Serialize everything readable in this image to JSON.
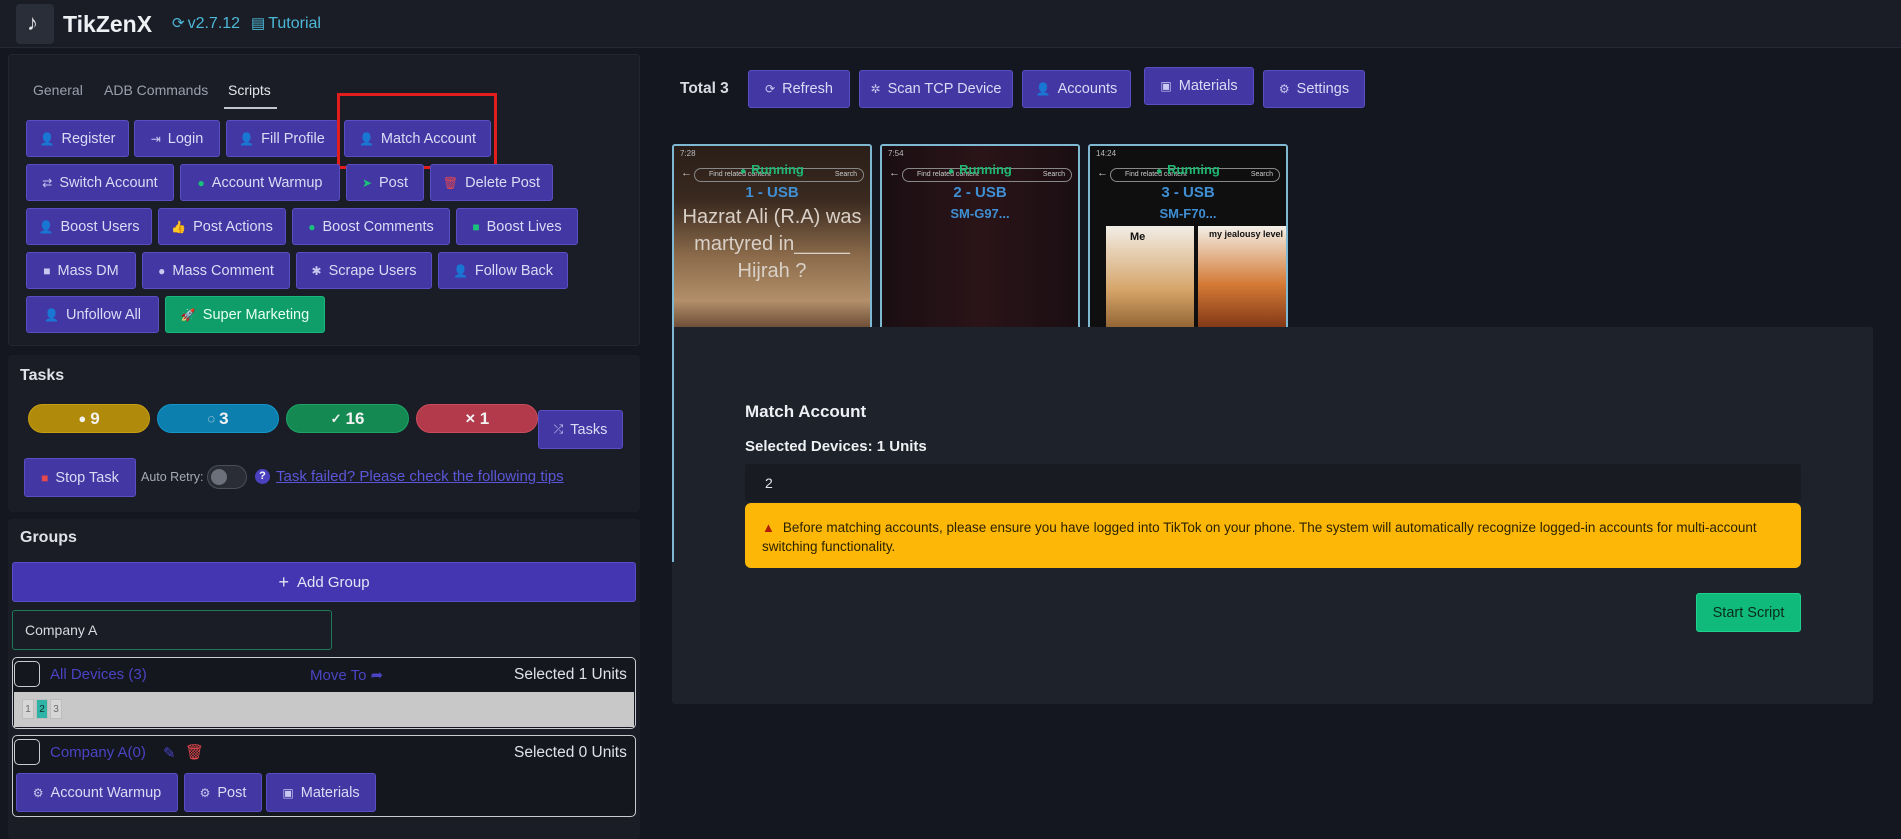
{
  "header": {
    "app_title": "TikZenX",
    "version": "v2.7.12",
    "tutorial": "Tutorial"
  },
  "tabs": [
    "General",
    "ADB Commands",
    "Scripts"
  ],
  "active_tab": "Scripts",
  "script_buttons": {
    "register": "Register",
    "login": "Login",
    "fill_profile": "Fill Profile",
    "match_account": "Match Account",
    "switch_account": "Switch Account",
    "account_warmup": "Account Warmup",
    "post": "Post",
    "delete_post": "Delete Post",
    "boost_users": "Boost Users",
    "post_actions": "Post Actions",
    "boost_comments": "Boost Comments",
    "boost_lives": "Boost Lives",
    "mass_dm": "Mass DM",
    "mass_comment": "Mass Comment",
    "scrape_users": "Scrape Users",
    "follow_back": "Follow Back",
    "unfollow_all": "Unfollow All",
    "super_marketing": "Super Marketing"
  },
  "tasks": {
    "title": "Tasks",
    "counts": {
      "pending": "9",
      "running": "3",
      "success": "16",
      "failed": "1"
    },
    "tasks_button": "Tasks",
    "stop_task": "Stop Task",
    "auto_retry_label": "Auto Retry:",
    "auto_retry": false,
    "tip_link": "Task failed? Please check the following tips"
  },
  "groups": {
    "title": "Groups",
    "add_group": "Add Group",
    "input_value": "Company A",
    "all_devices": {
      "name": "All Devices (3)",
      "move_to": "Move To",
      "selected": "Selected 1 Units",
      "chips": [
        "1",
        "2",
        "3"
      ]
    },
    "company": {
      "name": "Company A(0)",
      "selected": "Selected 0 Units",
      "buttons": [
        "Account Warmup",
        "Post",
        "Materials"
      ]
    }
  },
  "toolbar": {
    "total": "Total 3",
    "refresh": "Refresh",
    "scan": "Scan TCP Device",
    "accounts": "Accounts",
    "materials": "Materials",
    "settings": "Settings"
  },
  "devices": [
    {
      "status": "Running",
      "id": "1 - USB",
      "model": "",
      "screen_text": "Hazrat Ali (R.A) was martyred in_____ Hijrah  ?",
      "search_placeholder": "Find related content",
      "search_button": "Search",
      "status_time": "7:28"
    },
    {
      "status": "Running",
      "id": "2 - USB",
      "model": "SM-G97...",
      "search_placeholder": "Find related content",
      "search_button": "Search",
      "status_time": "7:54"
    },
    {
      "status": "Running",
      "id": "3 - USB",
      "model": "SM-F70...",
      "search_placeholder": "Find related content",
      "search_button": "Search",
      "status_time": "14:24",
      "meme_left": "Me",
      "meme_right": "my jealousy level"
    }
  ],
  "modal": {
    "title": "Match Account",
    "selected_devices": "Selected Devices: 1 Units",
    "input_value": "2",
    "warning": "Before matching accounts, please ensure you have logged into TikTok on your phone. The system will automatically recognize logged-in accounts for multi-account switching functionality.",
    "start_button": "Start Script"
  },
  "colors": {
    "primary": "#4337a4",
    "success": "#0fba7a",
    "warning": "#fdb707",
    "danger": "#e5484d",
    "accent": "#4cb8d8"
  },
  "icons": [
    "refresh-icon",
    "file-icon",
    "user-plus-icon",
    "sign-in-icon",
    "rocket-icon",
    "check-icon",
    "times-icon",
    "spinner-icon",
    "shuffle-icon",
    "stop-icon",
    "plus-icon",
    "share-icon",
    "edit-icon",
    "trash-icon",
    "gear-icon",
    "film-icon",
    "warning-icon"
  ]
}
